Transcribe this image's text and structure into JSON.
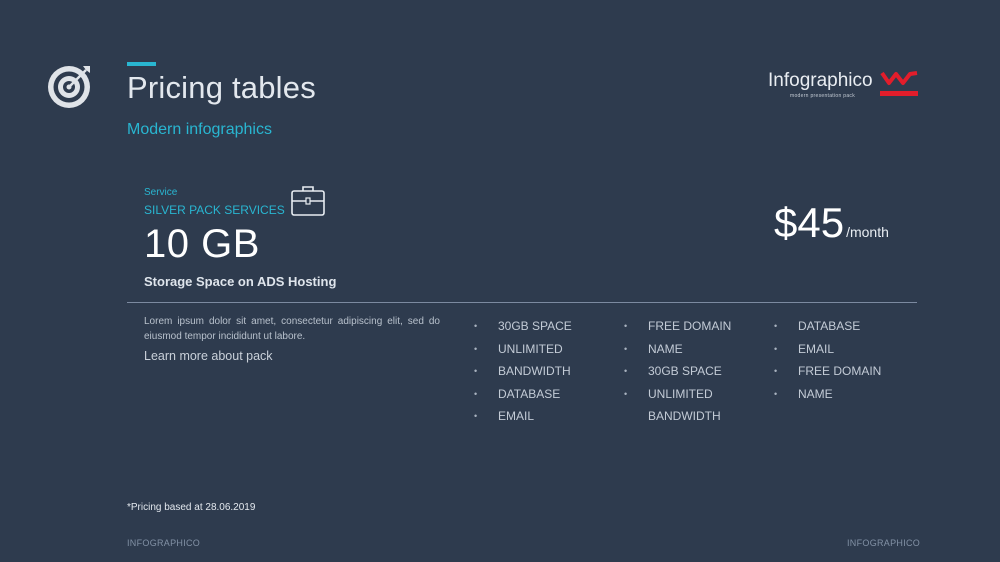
{
  "header": {
    "title": "Pricing tables",
    "subtitle": "Modern infographics",
    "target_icon": "target-icon"
  },
  "brand": {
    "name": "Infographico",
    "tagline": "modern presentation pack",
    "logo_icon": "w-logo-icon",
    "logo_color": "#e21d2b"
  },
  "plan": {
    "service_label": "Service",
    "service_name": "SILVER PACK SERVICES",
    "capacity": "10 GB",
    "storage_description": "Storage Space on ADS Hosting",
    "price": "$45",
    "period": "/month",
    "icon": "briefcase-icon",
    "description": "Lorem ipsum dolor sit amet, consectetur adipiscing elit, sed do eiusmod tempor incididunt ut labore.",
    "learn_more": "Learn more about pack"
  },
  "features": {
    "col1": [
      "30GB SPACE",
      "UNLIMITED",
      "BANDWIDTH",
      "DATABASE",
      "EMAIL"
    ],
    "col2": [
      "FREE DOMAIN",
      "NAME",
      "30GB SPACE",
      "UNLIMITED",
      "BANDWIDTH"
    ],
    "col3": [
      "DATABASE",
      "EMAIL",
      "FREE DOMAIN",
      "NAME"
    ]
  },
  "footnote": "*Pricing based  at 28.06.2019",
  "footer": {
    "left": "INFOGRAPHICO",
    "right": "INFOGRAPHICO"
  },
  "colors": {
    "background": "#2e3b4e",
    "accent": "#29b6d1"
  }
}
